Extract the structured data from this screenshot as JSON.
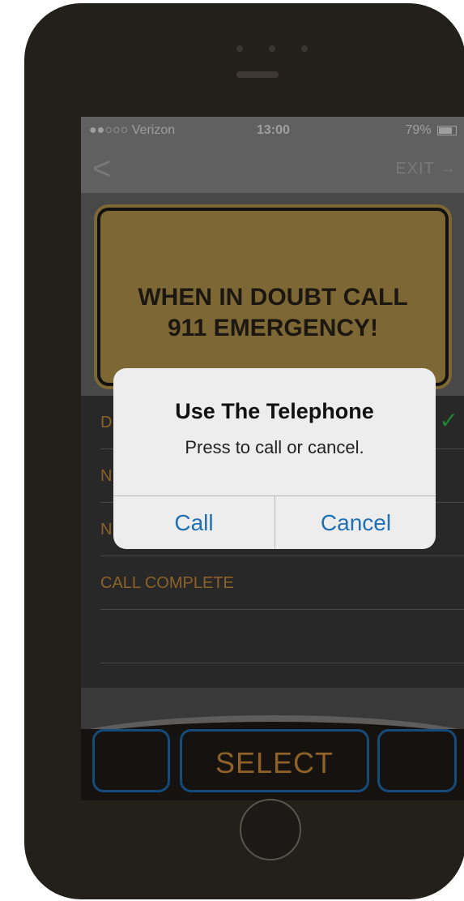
{
  "status_bar": {
    "carrier": "●●○○○ Verizon",
    "time": "13:00",
    "battery": "79%"
  },
  "navbar": {
    "back": "<",
    "exit": "EXIT →"
  },
  "sign": {
    "line1": "WHEN IN DOUBT CALL",
    "line2": "911 EMERGENCY!"
  },
  "list": {
    "row1": "DI",
    "row2": "N",
    "row3": "N",
    "row4": "CALL COMPLETE"
  },
  "buttons": {
    "select": "SELECT"
  },
  "alert": {
    "title": "Use The Telephone",
    "message": "Press to call or cancel.",
    "call": "Call",
    "cancel": "Cancel"
  },
  "colors": {
    "accent_blue": "#1f6fb5",
    "sign_gold": "#b99a4e",
    "label_orange": "#d0903a",
    "check_green": "#2dbf4c"
  }
}
